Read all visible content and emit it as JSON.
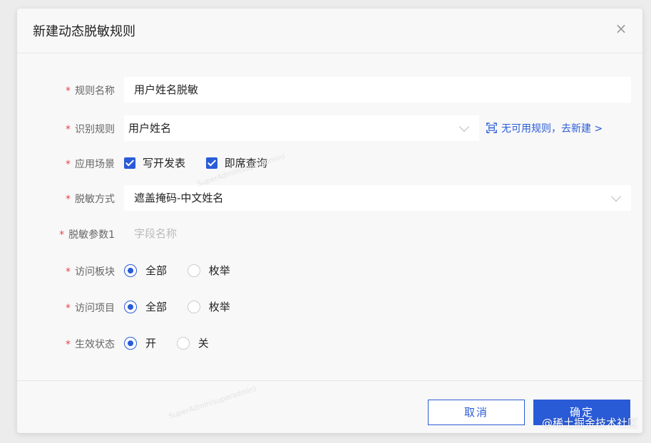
{
  "dialog": {
    "title": "新建动态脱敏规则",
    "close_symbol": "×"
  },
  "form": {
    "rule_name": {
      "label": "规则名称",
      "value": "用户姓名脱敏"
    },
    "recognition_rule": {
      "label": "识别规则",
      "value": "用户姓名",
      "link_text": "无可用规则，去新建 >"
    },
    "scene": {
      "label": "应用场景",
      "options": [
        {
          "label": "写开发表",
          "checked": true
        },
        {
          "label": "即席查询",
          "checked": true
        }
      ]
    },
    "mask_method": {
      "label": "脱敏方式",
      "value": "遮盖掩码-中文姓名"
    },
    "mask_param": {
      "label": "脱敏参数1",
      "placeholder": "字段名称"
    },
    "access_block": {
      "label": "访问板块",
      "options": [
        "全部",
        "枚举"
      ],
      "selected": "全部"
    },
    "access_project": {
      "label": "访问项目",
      "options": [
        "全部",
        "枚举"
      ],
      "selected": "全部"
    },
    "status": {
      "label": "生效状态",
      "options": [
        "开",
        "关"
      ],
      "selected": "开"
    }
  },
  "footer": {
    "cancel_label": "取消",
    "ok_label": "确定"
  },
  "watermark_text": "SuperAdmin(superadmin)",
  "site_mark": "@稀土掘金技术社区",
  "colors": {
    "accent": "#2a5bd7",
    "required": "#e0454a"
  }
}
